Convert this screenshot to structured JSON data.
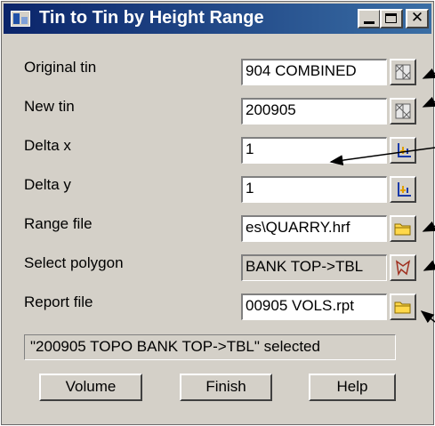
{
  "window": {
    "title": "Tin to Tin by Height Range",
    "icon": "app-window-icon",
    "controls": {
      "minimize": "minimize-icon",
      "maximize": "maximize-icon",
      "close": "✕"
    }
  },
  "fields": [
    {
      "label": "Original tin",
      "value": "904 COMBINED",
      "icon": "tin-select-icon"
    },
    {
      "label": "New tin",
      "value": "200905",
      "icon": "tin-select-icon"
    },
    {
      "label": "Delta x",
      "value": "1",
      "icon": "pick-coordinate-icon"
    },
    {
      "label": "Delta y",
      "value": "1",
      "icon": "pick-coordinate-icon"
    },
    {
      "label": "Range file",
      "value": "es\\QUARRY.hrf",
      "icon": "folder-icon"
    },
    {
      "label": "Select polygon",
      "value": "BANK TOP->TBL",
      "icon": "polygon-select-icon"
    },
    {
      "label": "Report file",
      "value": "00905 VOLS.rpt",
      "icon": "folder-icon"
    }
  ],
  "status": "\"200905 TOPO BANK TOP->TBL\" selected",
  "buttons": {
    "volume": "Volume",
    "finish": "Finish",
    "help": "Help"
  },
  "colors": {
    "titlebar_start": "#0a246a",
    "titlebar_end": "#3a6ea5",
    "dialog_bg": "#d4d0c8",
    "folder": "#ffd84a"
  }
}
